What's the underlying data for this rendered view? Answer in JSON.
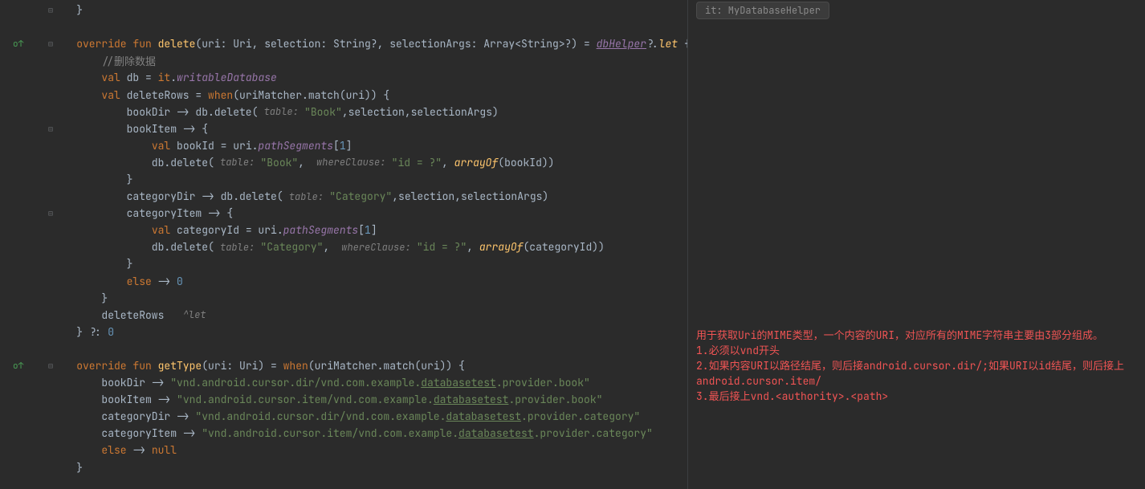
{
  "hint": "it: MyDatabaseHelper",
  "side_comment_lines": [
    "用于获取Uri的MIME类型，一个内容的URI，对应所有的MIME字符串主要由3部分组成。",
    "1.必须以vnd开头",
    "2.如果内容URI以路径结尾，则后接android.cursor.dir/;如果URI以id结尾，则后接上android.cursor.item/",
    "3.最后接上vnd.<authority>.<path>"
  ],
  "gutter": {
    "override_mark_lines": [
      2,
      21
    ],
    "fold_lines": [
      0,
      2,
      7,
      12,
      21
    ]
  },
  "code": {
    "l0": "    }",
    "l1": "",
    "l2_pre": "    ",
    "l2_kw1": "override fun ",
    "l2_fn": "delete",
    "l2_sig": "(uri: Uri, selection: String?, selectionArgs: Array<String>?) = ",
    "l2_db": "dbHelper",
    "l2_op": "?.",
    "l2_let": "let",
    "l2_brace": " {",
    "l3_pre": "        ",
    "l3_cmt": "//删除数据",
    "l4_pre": "        ",
    "l4_kw": "val ",
    "l4_v": "db = ",
    "l4_it": "it",
    "l4_dot": ".",
    "l4_prop": "writableDatabase",
    "l5_pre": "        ",
    "l5_kw": "val ",
    "l5_v": "deleteRows = ",
    "l5_when": "when",
    "l5_rest": "(uriMatcher.match(uri)) {",
    "l6_pre": "            bookDir -> db.delete(",
    "l6_lbl": " table: ",
    "l6_str": "\"Book\"",
    "l6_rest": ",selection,selectionArgs)",
    "l7_pre": "            bookItem -> {",
    "l8_pre": "                ",
    "l8_kw": "val ",
    "l8_v": "bookId = uri.",
    "l8_prop": "pathSegments",
    "l8_idx": "[",
    "l8_num": "1",
    "l8_idx2": "]",
    "l9_pre": "                db.delete(",
    "l9_lbl1": " table: ",
    "l9_str1": "\"Book\"",
    "l9_c1": ", ",
    "l9_lbl2": " whereClause: ",
    "l9_str2": "\"id = ?\"",
    "l9_c2": ", ",
    "l9_arr": "arrayOf",
    "l9_rest": "(bookId))",
    "l10": "            }",
    "l11_pre": "            categoryDir -> db.delete(",
    "l11_lbl": " table: ",
    "l11_str": "\"Category\"",
    "l11_rest": ",selection,selectionArgs)",
    "l12_pre": "            categoryItem -> {",
    "l13_pre": "                ",
    "l13_kw": "val ",
    "l13_v": "categoryId = uri.",
    "l13_prop": "pathSegments",
    "l13_idx": "[",
    "l13_num": "1",
    "l13_idx2": "]",
    "l14_pre": "                db.delete(",
    "l14_lbl1": " table: ",
    "l14_str1": "\"Category\"",
    "l14_c1": ", ",
    "l14_lbl2": " whereClause: ",
    "l14_str2": "\"id = ?\"",
    "l14_c2": ", ",
    "l14_arr": "arrayOf",
    "l14_rest": "(categoryId))",
    "l15": "            }",
    "l16_pre": "            ",
    "l16_else": "else",
    "l16_arr": " -> ",
    "l16_num": "0",
    "l17": "        }",
    "l18_pre": "        deleteRows   ",
    "l18_lbl": "^let",
    "l19_pre": "    } ?: ",
    "l19_num": "0",
    "l20": "",
    "l21_pre": "    ",
    "l21_kw": "override fun ",
    "l21_fn": "getType",
    "l21_sig": "(uri: Uri) = ",
    "l21_when": "when",
    "l21_rest": "(uriMatcher.match(uri)) {",
    "l22_pre": "        bookDir -> ",
    "l22_s1": "\"vnd.android.cursor.dir/vnd.com.example.",
    "l22_u": "databasetest",
    "l22_s2": ".provider.book\"",
    "l23_pre": "        bookItem -> ",
    "l23_s1": "\"vnd.android.cursor.item/vnd.com.example.",
    "l23_u": "databasetest",
    "l23_s2": ".provider.book\"",
    "l24_pre": "        categoryDir -> ",
    "l24_s1": "\"vnd.android.cursor.dir/vnd.com.example.",
    "l24_u": "databasetest",
    "l24_s2": ".provider.category\"",
    "l25_pre": "        categoryItem -> ",
    "l25_s1": "\"vnd.android.cursor.item/vnd.com.example.",
    "l25_u": "databasetest",
    "l25_s2": ".provider.category\"",
    "l26_pre": "        ",
    "l26_else": "else",
    "l26_arr": " -> ",
    "l26_null": "null",
    "l27": "    }"
  }
}
